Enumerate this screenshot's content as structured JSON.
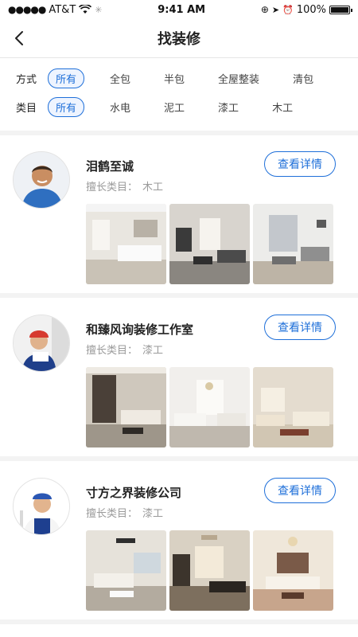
{
  "status_bar": {
    "carrier": "AT&T",
    "time": "9:41 AM",
    "battery": "100%"
  },
  "nav": {
    "title": "找装修"
  },
  "filters": {
    "method": {
      "label": "方式",
      "options": [
        "所有",
        "全包",
        "半包",
        "全屋整装",
        "清包"
      ],
      "selected": "所有"
    },
    "category": {
      "label": "类目",
      "options": [
        "所有",
        "水电",
        "泥工",
        "漆工",
        "木工"
      ],
      "selected": "所有"
    }
  },
  "cards": [
    {
      "name": "泪鹤至诚",
      "category_label": "擅长类目：",
      "category_value": "木工",
      "button": "查看详情",
      "photos": 3
    },
    {
      "name": "和臻风询装修工作室",
      "category_label": "擅长类目：",
      "category_value": "漆工",
      "button": "查看详情",
      "photos": 3
    },
    {
      "name": "寸方之界装修公司",
      "category_label": "擅长类目：",
      "category_value": "漆工",
      "button": "查看详情",
      "photos": 3
    }
  ],
  "colors": {
    "accent": "#1e6fd9",
    "muted_text": "#9a9a9a"
  }
}
